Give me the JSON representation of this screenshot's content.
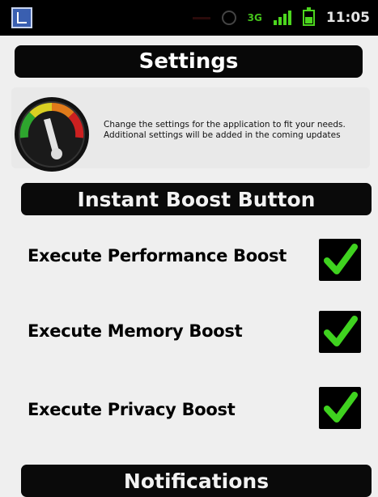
{
  "status_bar": {
    "time": "11:05",
    "network_label": "3G",
    "icons": [
      "app-icon",
      "battery-low-icon",
      "gps-icon",
      "3g-icon",
      "signal-icon",
      "battery-icon"
    ]
  },
  "screen_title": "Settings",
  "header": {
    "icon": "speedometer-gauge-icon",
    "description": "Change the settings for the application to fit your needs. Additional settings will be added in the coming updates"
  },
  "sections": [
    {
      "title": "Instant Boost Button",
      "options": [
        {
          "label": "Execute Performance Boost",
          "checked": true
        },
        {
          "label": "Execute Memory Boost",
          "checked": true
        },
        {
          "label": "Execute Privacy Boost",
          "checked": true
        }
      ]
    },
    {
      "title": "Notifications",
      "options": []
    }
  ],
  "colors": {
    "check_green": "#3fd21f",
    "bar_black": "#0a0a0a",
    "background": "#efefef"
  }
}
